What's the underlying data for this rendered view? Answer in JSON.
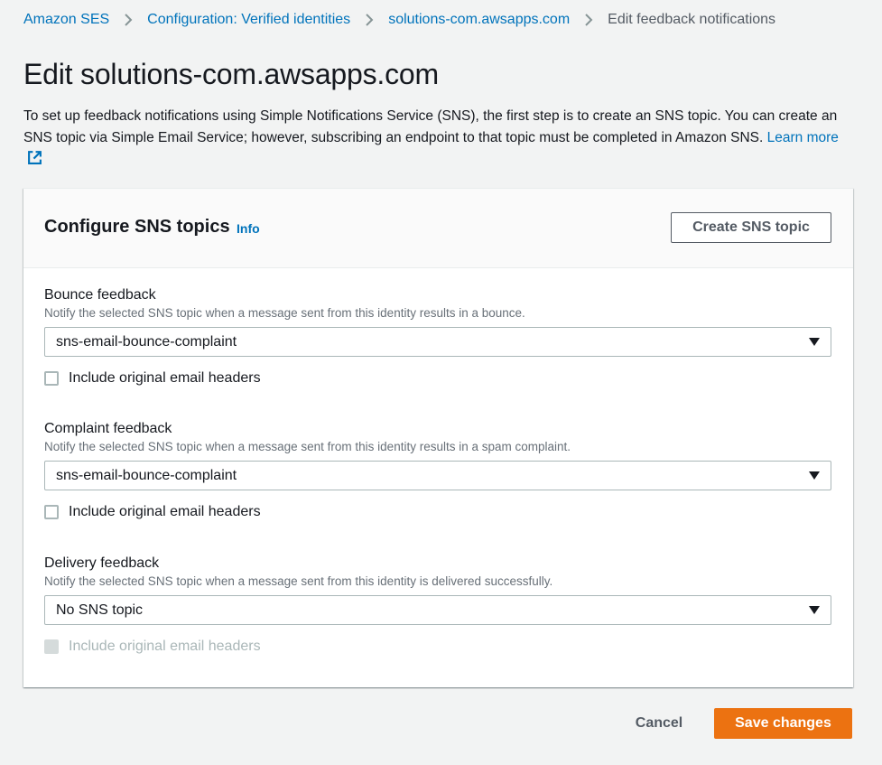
{
  "breadcrumb": {
    "items": [
      "Amazon SES",
      "Configuration: Verified identities",
      "solutions-com.awsapps.com"
    ],
    "current": "Edit feedback notifications"
  },
  "page": {
    "title": "Edit solutions-com.awsapps.com",
    "description": "To set up feedback notifications using Simple Notifications Service (SNS), the first step is to create an SNS topic. You can create an SNS topic via Simple Email Service; however, subscribing an endpoint to that topic must be completed in Amazon SNS.",
    "learn_more": "Learn more"
  },
  "card": {
    "title": "Configure SNS topics",
    "info": "Info",
    "create_button": "Create SNS topic"
  },
  "fields": [
    {
      "label": "Bounce feedback",
      "description": "Notify the selected SNS topic when a message sent from this identity results in a bounce.",
      "selected": "sns-email-bounce-complaint",
      "checkbox_label": "Include original email headers",
      "checked": false,
      "checkbox_disabled": false
    },
    {
      "label": "Complaint feedback",
      "description": "Notify the selected SNS topic when a message sent from this identity results in a spam complaint.",
      "selected": "sns-email-bounce-complaint",
      "checkbox_label": "Include original email headers",
      "checked": false,
      "checkbox_disabled": false
    },
    {
      "label": "Delivery feedback",
      "description": "Notify the selected SNS topic when a message sent from this identity is delivered successfully.",
      "selected": "No SNS topic",
      "checkbox_label": "Include original email headers",
      "checked": false,
      "checkbox_disabled": true
    }
  ],
  "actions": {
    "cancel": "Cancel",
    "save": "Save changes"
  },
  "colors": {
    "link": "#0073bb",
    "primary_button": "#ec7211",
    "background": "#f2f3f3"
  }
}
